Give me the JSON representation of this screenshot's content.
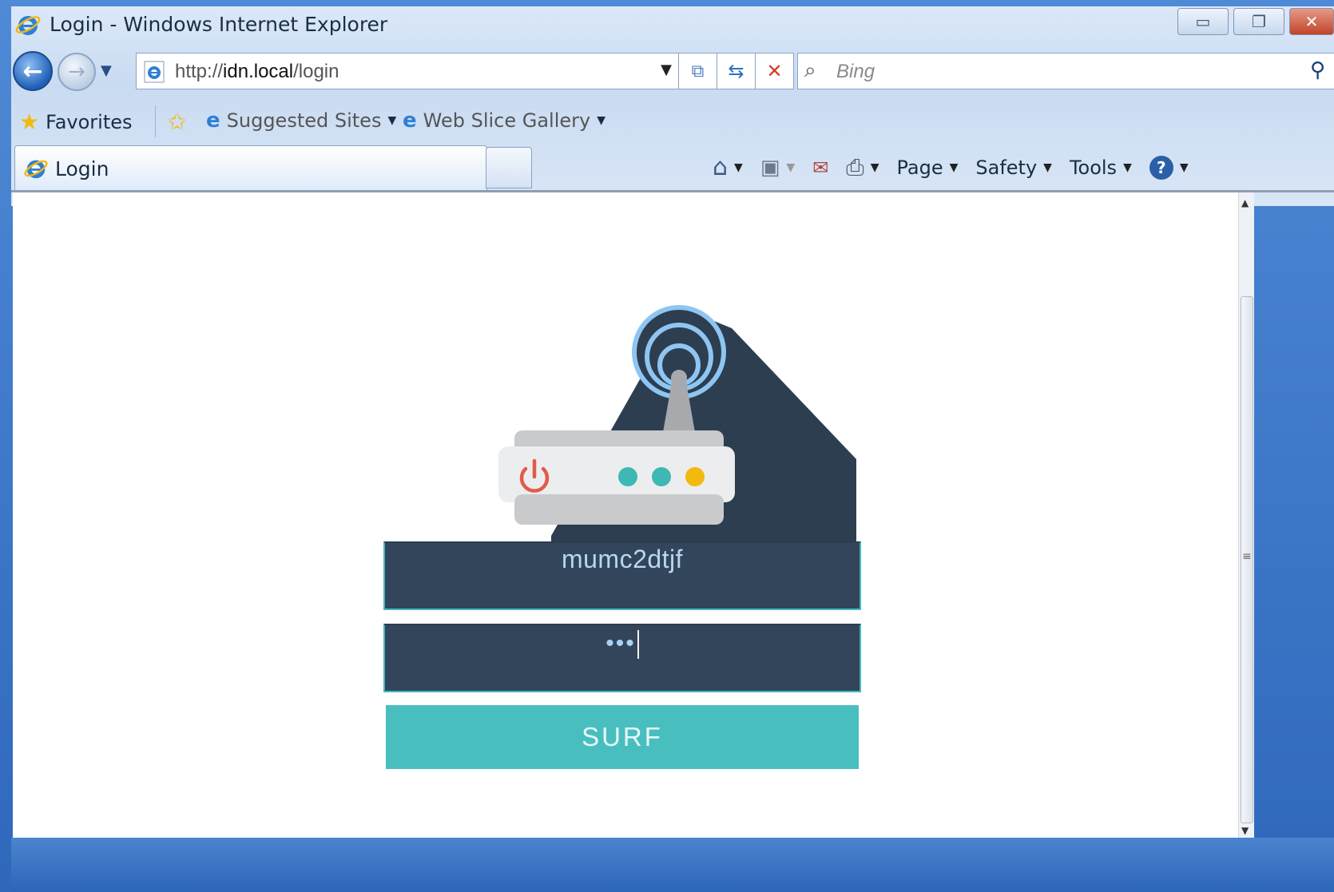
{
  "window": {
    "title": "Login - Windows Internet Explorer",
    "buttons": {
      "minimize_icon": "minimize-icon",
      "restore_icon": "restore-icon",
      "close_icon": "close-icon"
    }
  },
  "address_bar": {
    "url_prefix": "http://",
    "url_host": "idn.local",
    "url_path": "/login",
    "search_placeholder": "Bing"
  },
  "favorites_bar": {
    "favorites_label": "Favorites",
    "suggested_sites_label": "Suggested Sites",
    "web_slice_gallery_label": "Web Slice Gallery"
  },
  "tab": {
    "title": "Login"
  },
  "command_bar": {
    "page_label": "Page",
    "safety_label": "Safety",
    "tools_label": "Tools"
  },
  "login_form": {
    "username_value": "mumc2dtjf",
    "password_masked": "•••",
    "submit_label": "SURF"
  },
  "colors": {
    "field_bg": "#33455a",
    "button_bg": "#49bebf",
    "router_shadow": "#2c3e50",
    "power_red": "#e05c4a",
    "led_teal": "#3db8b4",
    "led_yellow": "#f2b90f",
    "wifi_blue": "#8ec5f2"
  }
}
